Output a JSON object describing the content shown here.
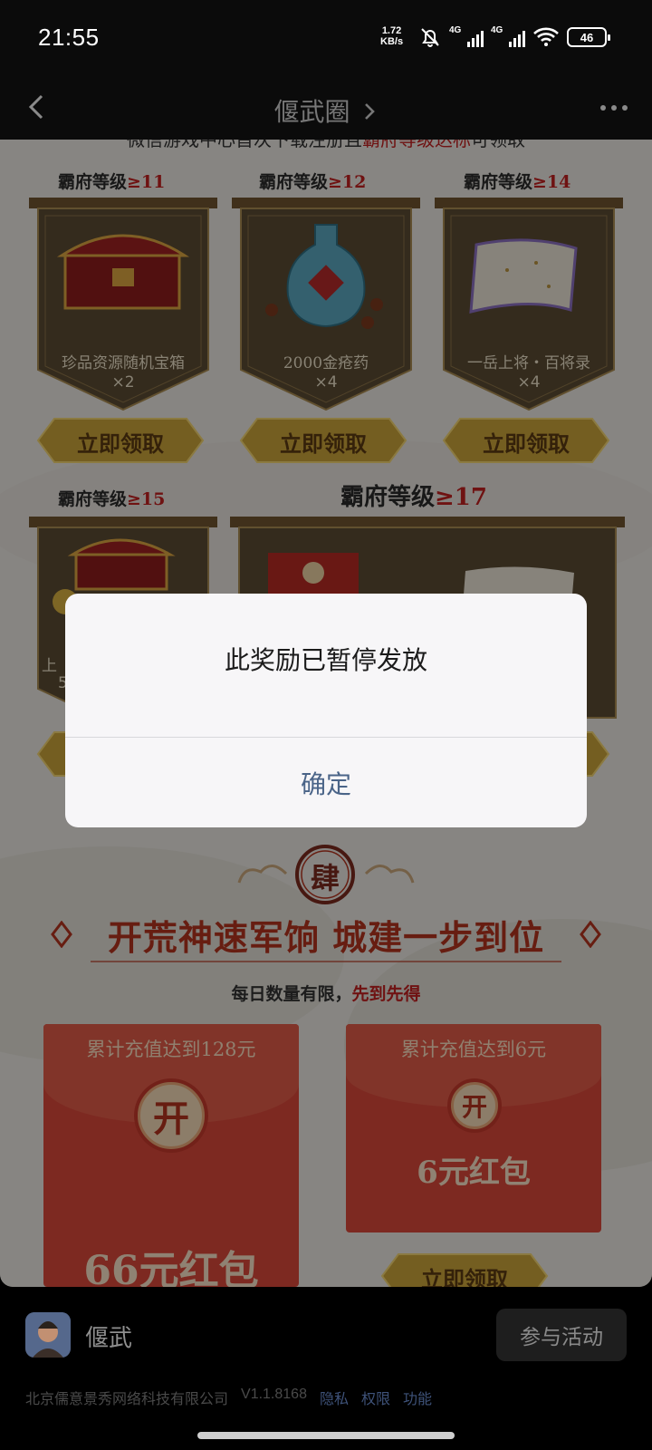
{
  "status_bar": {
    "time": "21:55",
    "net_speed_value": "1.72",
    "net_speed_unit": "KB/s",
    "signal1_label": "4G",
    "signal2_label": "4G",
    "battery": "46"
  },
  "nav": {
    "title": "偃武圈"
  },
  "page": {
    "top_text_prefix": "微信游戏中心首次下载注册且",
    "top_text_red": "霸府等级达标",
    "top_text_suffix": "可领取",
    "rewards": [
      {
        "level_label": "霸府等级",
        "level_num": "≥11",
        "name": "珍品资源随机宝箱",
        "qty": "×2",
        "claim": "立即领取"
      },
      {
        "level_label": "霸府等级",
        "level_num": "≥12",
        "name": "2000金疮药",
        "qty": "×4",
        "claim": "立即领取"
      },
      {
        "level_label": "霸府等级",
        "level_num": "≥14",
        "name": "一岳上将・百将录",
        "qty": "×4",
        "claim": "立即领取"
      },
      {
        "level_label": "霸府等级",
        "level_num": "≥15",
        "name": "上",
        "qty": "5"
      },
      {
        "level_label": "霸府等级",
        "level_num": "≥17"
      }
    ],
    "section_badge": "肆",
    "headline": "开荒神速军饷 城建一步到位",
    "subline_prefix": "每日数量有限，",
    "subline_red": "先到先得",
    "envelopes": [
      {
        "condition": "累计充值达到128元",
        "open": "开",
        "amount": "66元红包"
      },
      {
        "condition": "累计充值达到6元",
        "open": "开",
        "amount": "6元红包",
        "claim": "立即领取"
      }
    ]
  },
  "dialog": {
    "message": "此奖励已暂停发放",
    "confirm": "确定"
  },
  "bottom": {
    "app_name": "偃武",
    "join_button": "参与活动",
    "company": "北京儒意景秀网络科技有限公司",
    "version": "V1.1.8168",
    "privacy": "隐私",
    "permissions": "权限",
    "features": "功能"
  },
  "colors": {
    "accent_red": "#c02020",
    "dialog_confirm": "#4a6488",
    "envelope_red": "#d7483a"
  }
}
